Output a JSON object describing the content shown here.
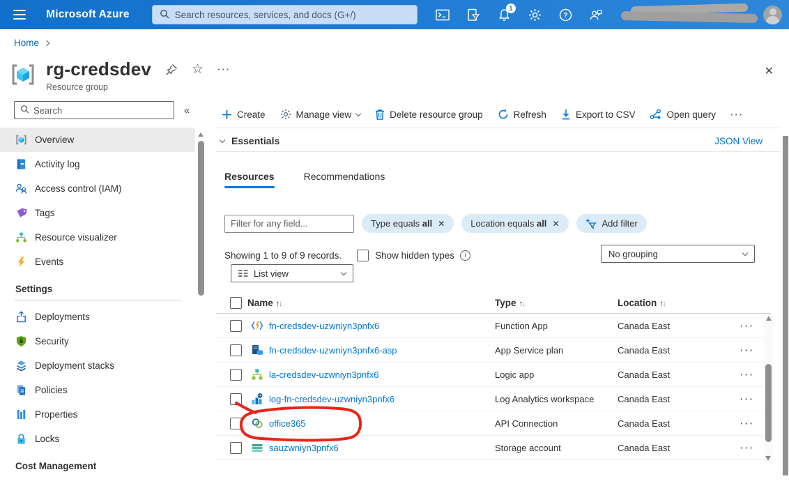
{
  "topbar": {
    "brand": "Microsoft Azure",
    "search_placeholder": "Search resources, services, and docs (G+/)",
    "notification_badge": "1",
    "icons": [
      "hamburger-menu-icon",
      "search-icon",
      "cloud-shell-icon",
      "directory-filter-icon",
      "notifications-bell-icon",
      "settings-gear-icon",
      "help-icon",
      "feedback-icon",
      "account-avatar"
    ]
  },
  "breadcrumb": {
    "home": "Home"
  },
  "page_header": {
    "title": "rg-credsdev",
    "subtitle": "Resource group",
    "icons": [
      "resource-group-icon",
      "pin-icon",
      "star-icon",
      "more-icon",
      "close-icon"
    ]
  },
  "sidebar": {
    "search_placeholder": "Search",
    "collapse_glyph": "«",
    "items": [
      {
        "label": "Overview",
        "icon": "resource-group-icon",
        "selected": true
      },
      {
        "label": "Activity log",
        "icon": "activity-log-icon"
      },
      {
        "label": "Access control (IAM)",
        "icon": "access-control-icon"
      },
      {
        "label": "Tags",
        "icon": "tag-icon"
      },
      {
        "label": "Resource visualizer",
        "icon": "resource-visualizer-icon"
      },
      {
        "label": "Events",
        "icon": "events-icon"
      }
    ],
    "settings_section": {
      "label": "Settings",
      "items": [
        {
          "label": "Deployments",
          "icon": "deployments-icon"
        },
        {
          "label": "Security",
          "icon": "security-icon"
        },
        {
          "label": "Deployment stacks",
          "icon": "deployment-stacks-icon"
        },
        {
          "label": "Policies",
          "icon": "policies-icon"
        },
        {
          "label": "Properties",
          "icon": "properties-icon"
        },
        {
          "label": "Locks",
          "icon": "locks-icon"
        }
      ]
    },
    "cost_section_label": "Cost Management"
  },
  "toolbar": {
    "create": "Create",
    "manage_view": "Manage view",
    "delete": "Delete resource group",
    "refresh": "Refresh",
    "export_csv": "Export to CSV",
    "open_query": "Open query",
    "more": "···"
  },
  "essentials": {
    "label": "Essentials",
    "json_view_link": "JSON View"
  },
  "tabs": [
    {
      "label": "Resources"
    },
    {
      "label": "Recommendations"
    }
  ],
  "filter_bar": {
    "input_placeholder": "Filter for any field...",
    "pills": [
      {
        "prefix": "Type equals",
        "value": "all",
        "remove_glyph": "✕"
      },
      {
        "prefix": "Location equals",
        "value": "all",
        "remove_glyph": "✕"
      }
    ],
    "add_filter_label": "Add filter"
  },
  "list_controls": {
    "records_text": "Showing 1 to 9 of 9 records.",
    "show_hidden_label": "Show hidden types",
    "grouping_value": "No grouping",
    "view_value": "List view"
  },
  "table": {
    "columns": [
      "Name",
      "Type",
      "Location"
    ],
    "row_more_glyph": "···",
    "rows": [
      {
        "name": "fn-credsdev-uzwniyn3pnfx6",
        "type": "Function App",
        "location": "Canada East",
        "icon": "function-app-icon"
      },
      {
        "name": "fn-credsdev-uzwniyn3pnfx6-asp",
        "type": "App Service plan",
        "location": "Canada East",
        "icon": "app-service-plan-icon"
      },
      {
        "name": "la-credsdev-uzwniyn3pnfx6",
        "type": "Logic app",
        "location": "Canada East",
        "icon": "logic-app-icon"
      },
      {
        "name": "log-fn-credsdev-uzwniyn3pnfx6",
        "type": "Log Analytics workspace",
        "location": "Canada East",
        "icon": "log-analytics-workspace-icon"
      },
      {
        "name": "office365",
        "type": "API Connection",
        "location": "Canada East",
        "icon": "api-connection-icon",
        "annotation": "red-ink-circle"
      },
      {
        "name": "sauzwniyn3pnfx6",
        "type": "Storage account",
        "location": "Canada East",
        "icon": "storage-account-icon"
      }
    ]
  },
  "colors": {
    "topbar_blue": "#1374d4",
    "accent_blue": "#0078d4",
    "pill_bg": "#dcebf8",
    "annotation_red": "#e5271b",
    "selected_item_bg": "#ebebeb"
  }
}
